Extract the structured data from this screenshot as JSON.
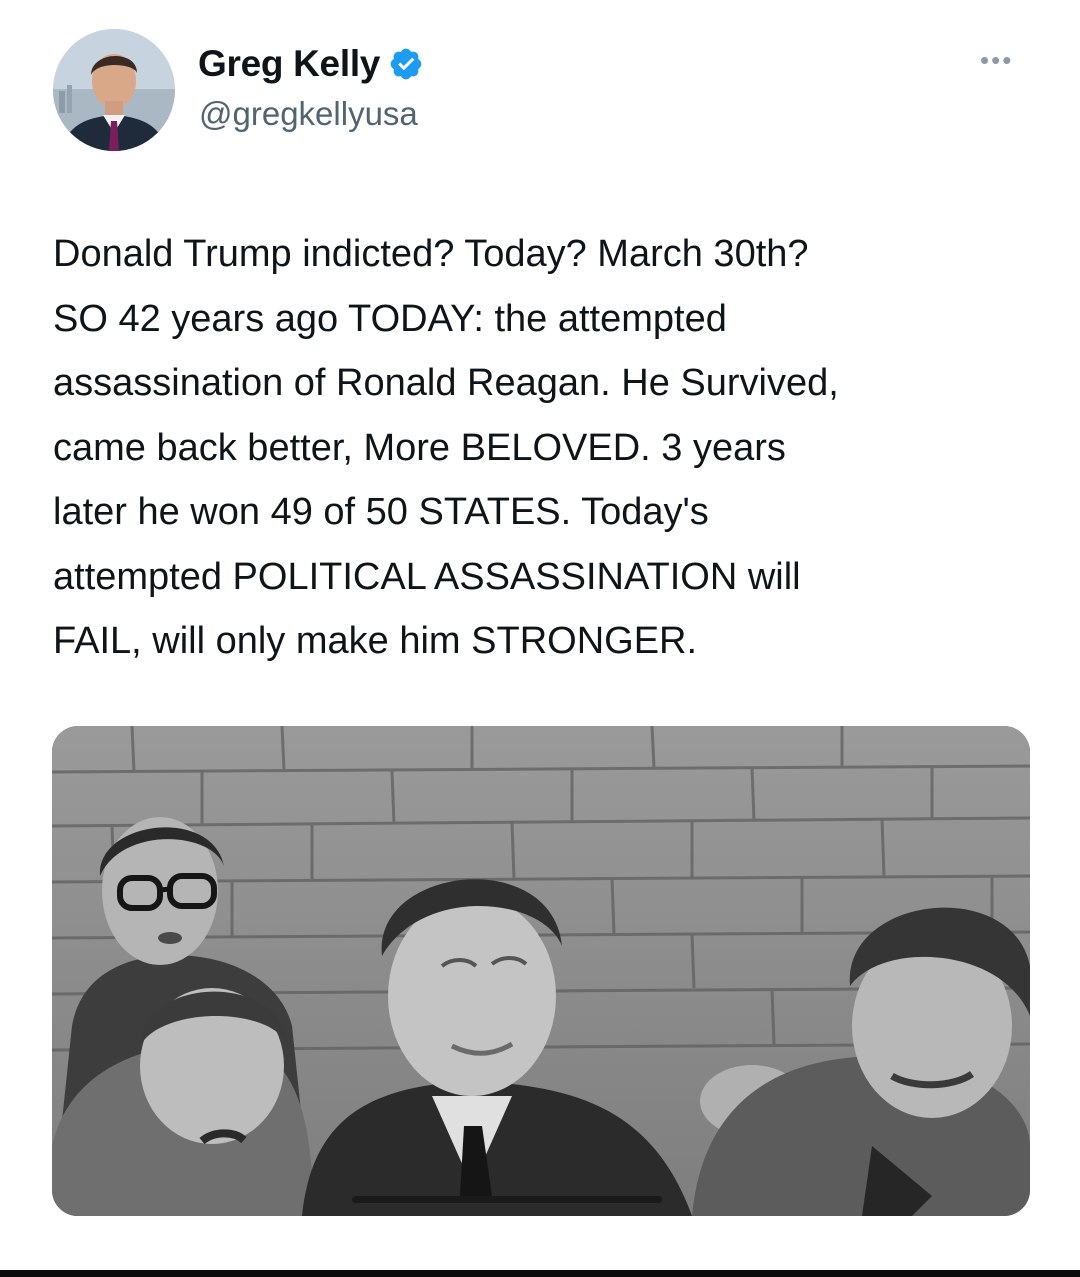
{
  "author": {
    "display_name": "Greg Kelly",
    "handle": "@gregkellyusa",
    "verified": true,
    "verified_color": "#1d9bf0"
  },
  "more_menu_icon": "more-dots-icon",
  "tweet": {
    "text": "Donald Trump indicted? Today? March 30th?\nSO 42 years ago TODAY: the attempted\nassassination of Ronald Reagan. He Survived,\ncame back better, More BELOVED.  3 years\nlater he won 49 of 50 STATES. Today's\nattempted POLITICAL ASSASSINATION will\nFAIL, will only make him STRONGER."
  },
  "media": {
    "type": "black-and-white photograph"
  },
  "colors": {
    "name": "#0f1419",
    "handle": "#536471",
    "background": "#ffffff"
  }
}
